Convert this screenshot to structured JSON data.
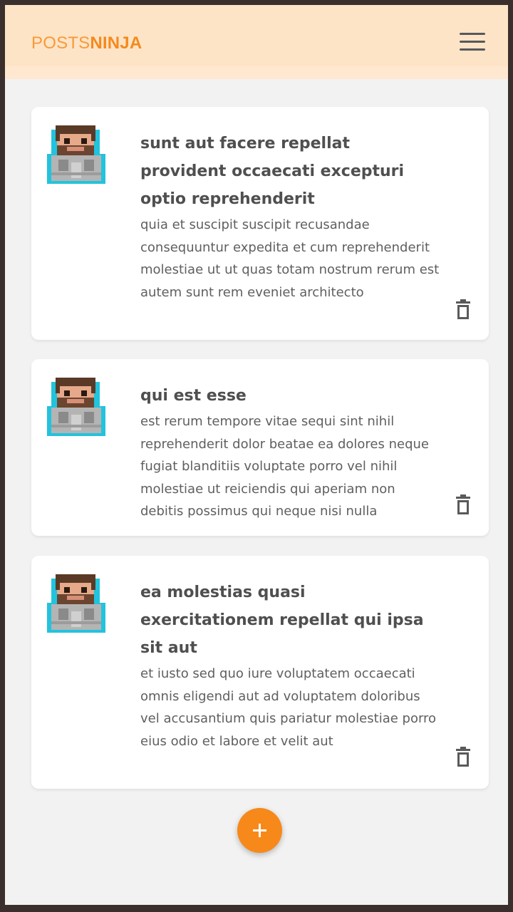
{
  "app": {
    "brand_part1": "POSTS",
    "brand_part2": "NINJA",
    "menu_icon": "hamburger-menu-icon",
    "accent": "#f7891a",
    "header_bg": "#fee4c6"
  },
  "posts": [
    {
      "title": "sunt aut facere repellat provident occaecati excepturi optio reprehenderit",
      "body": "quia et suscipit suscipit recusandae consequuntur expedita et cum reprehenderit molestiae ut ut quas totam nostrum rerum est autem sunt rem eveniet architecto",
      "avatar_icon": "pixel-avatar-icon",
      "delete_icon": "trash-icon"
    },
    {
      "title": "qui est esse",
      "body": "est rerum tempore vitae sequi sint nihil reprehenderit dolor beatae ea dolores neque fugiat blanditiis voluptate porro vel nihil molestiae ut reiciendis qui aperiam non debitis possimus qui neque nisi nulla",
      "avatar_icon": "pixel-avatar-icon",
      "delete_icon": "trash-icon"
    },
    {
      "title": "ea molestias quasi exercitationem repellat qui ipsa sit aut",
      "body": "et iusto sed quo iure voluptatem occaecati omnis eligendi aut ad voluptatem doloribus vel accusantium quis pariatur molestiae porro eius odio et labore et velit aut",
      "avatar_icon": "pixel-avatar-icon",
      "delete_icon": "trash-icon"
    }
  ],
  "add_button": {
    "icon": "plus-icon"
  }
}
